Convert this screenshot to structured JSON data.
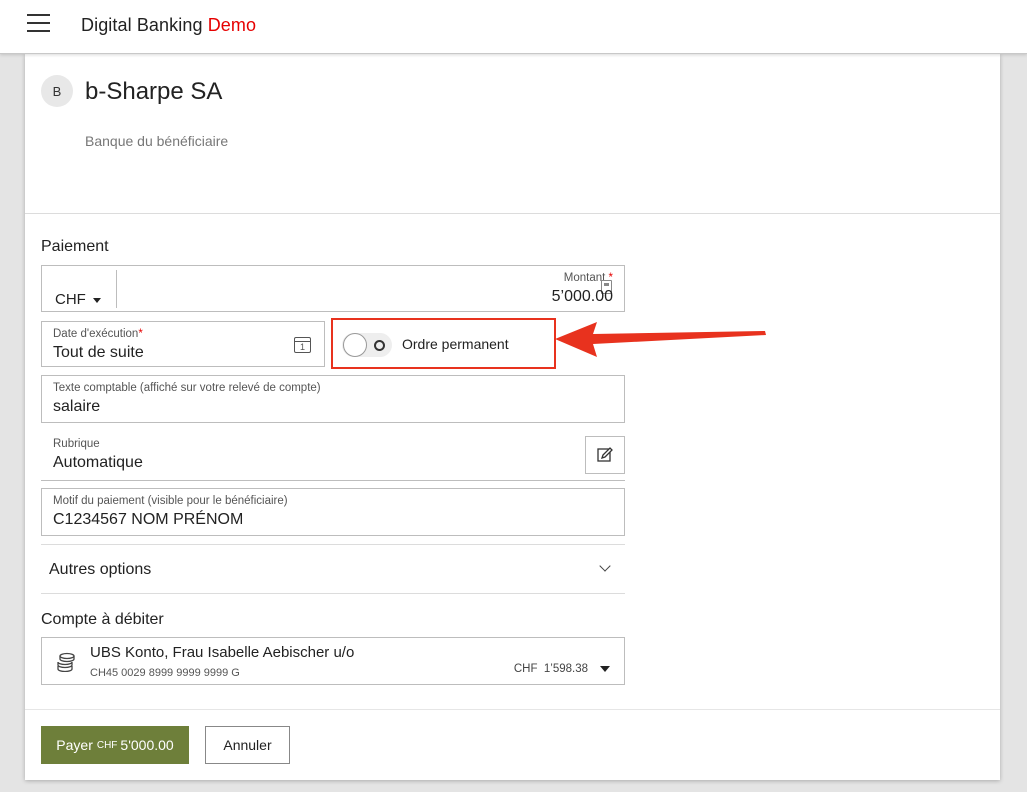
{
  "header": {
    "title_main": "Digital Banking",
    "title_accent": "Demo",
    "accent_color": "#e60000"
  },
  "beneficiary": {
    "initial": "B",
    "name": "b-Sharpe SA",
    "bank_label": "Banque du bénéficiaire"
  },
  "payment": {
    "section_title": "Paiement",
    "currency": "CHF",
    "amount_label": "Montant",
    "amount_required": "*",
    "amount_value": "5’000.00",
    "date_label": "Date d'exécution",
    "date_required": "*",
    "date_value": "Tout de suite",
    "standing_order_label": "Ordre permanent",
    "standing_order_on": false,
    "booking_text_label": "Texte comptable (affiché sur votre relevé de compte)",
    "booking_text_value": "salaire",
    "category_label": "Rubrique",
    "category_value": "Automatique",
    "reason_label": "Motif du paiement (visible pour le bénéficiaire)",
    "reason_value": "C1234567 NOM PRÉNOM",
    "other_options": "Autres options"
  },
  "debit_account": {
    "section_title": "Compte à débiter",
    "name": "UBS Konto, Frau Isabelle Aebischer u/o",
    "iban": "CH45 0029 8999 9999 9999 G",
    "currency": "CHF",
    "balance": "1’598.38"
  },
  "actions": {
    "pay_label": "Payer",
    "pay_currency": "CHF",
    "pay_amount": "5'000.00",
    "cancel_label": "Annuler",
    "pay_color": "#6e7f3a"
  },
  "annotation": {
    "highlight_color": "#e8321e"
  }
}
